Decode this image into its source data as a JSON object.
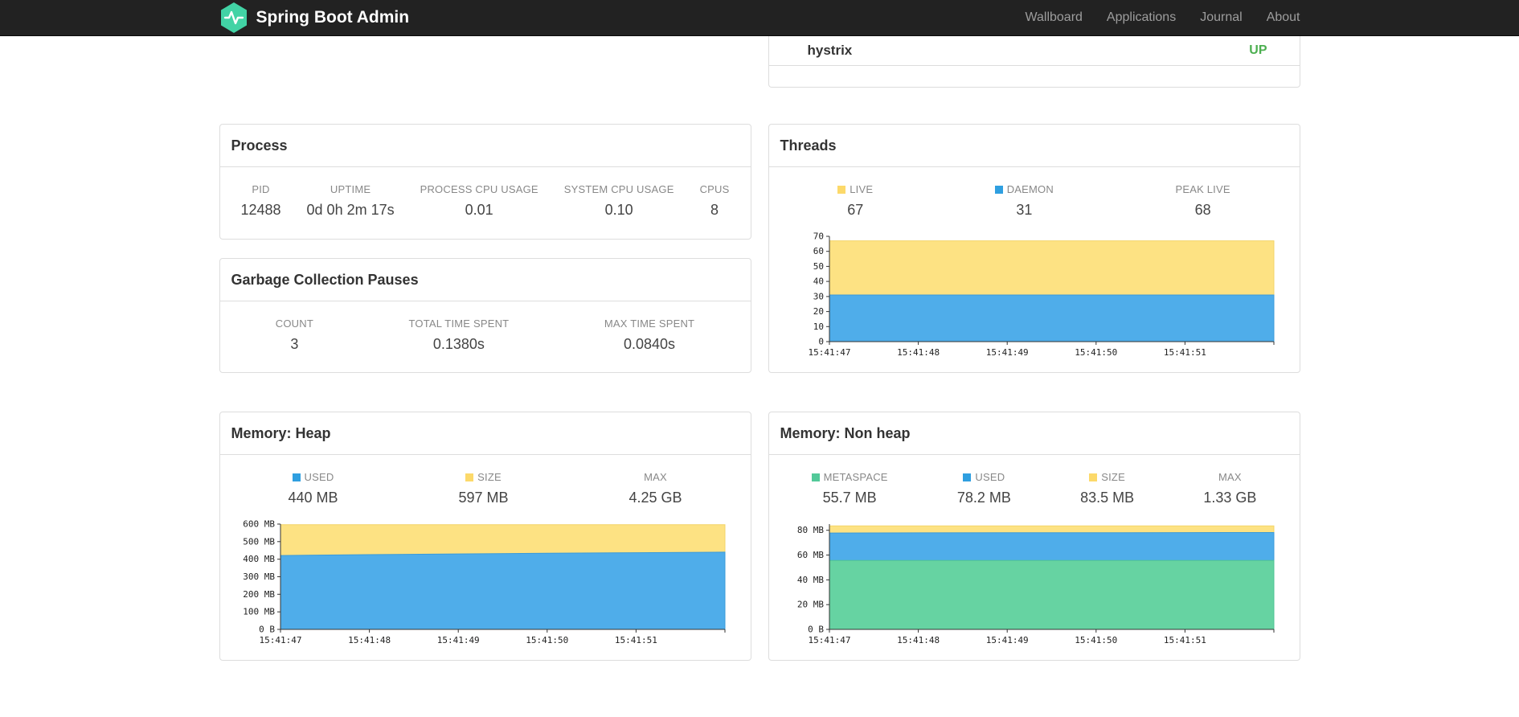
{
  "navbar": {
    "brand": "Spring Boot Admin",
    "logo_color": "#42d3a5",
    "links": [
      {
        "label": "Wallboard"
      },
      {
        "label": "Applications"
      },
      {
        "label": "Journal"
      },
      {
        "label": "About"
      }
    ]
  },
  "colors": {
    "status_up": "#4caf50",
    "chart_yellow": "#fde283",
    "chart_blue": "#4fadea",
    "chart_green": "#66d3a2"
  },
  "health": {
    "item_label": "hystrix",
    "item_status": "UP"
  },
  "process": {
    "title": "Process",
    "stats": [
      {
        "label": "PID",
        "value": "12488"
      },
      {
        "label": "UPTIME",
        "value": "0d 0h 2m 17s"
      },
      {
        "label": "PROCESS CPU USAGE",
        "value": "0.01"
      },
      {
        "label": "SYSTEM CPU USAGE",
        "value": "0.10"
      },
      {
        "label": "CPUS",
        "value": "8"
      }
    ]
  },
  "gc": {
    "title": "Garbage Collection Pauses",
    "stats": [
      {
        "label": "COUNT",
        "value": "3"
      },
      {
        "label": "TOTAL TIME SPENT",
        "value": "0.1380s"
      },
      {
        "label": "MAX TIME SPENT",
        "value": "0.0840s"
      }
    ]
  },
  "threads": {
    "title": "Threads",
    "stats": [
      {
        "label": "LIVE",
        "value": "67",
        "swatch": "#fcd96a"
      },
      {
        "label": "DAEMON",
        "value": "31",
        "swatch": "#2f9fe0"
      },
      {
        "label": "PEAK LIVE",
        "value": "68"
      }
    ]
  },
  "heap": {
    "title": "Memory: Heap",
    "stats": [
      {
        "label": "USED",
        "value": "440 MB",
        "swatch": "#2f9fe0"
      },
      {
        "label": "SIZE",
        "value": "597 MB",
        "swatch": "#fcd96a"
      },
      {
        "label": "MAX",
        "value": "4.25 GB"
      }
    ]
  },
  "nonheap": {
    "title": "Memory: Non heap",
    "stats": [
      {
        "label": "METASPACE",
        "value": "55.7 MB",
        "swatch": "#52c999"
      },
      {
        "label": "USED",
        "value": "78.2 MB",
        "swatch": "#2f9fe0"
      },
      {
        "label": "SIZE",
        "value": "83.5 MB",
        "swatch": "#fcd96a"
      },
      {
        "label": "MAX",
        "value": "1.33 GB"
      }
    ]
  },
  "chart_data": [
    {
      "type": "area",
      "title": "Threads",
      "x": [
        "15:41:47",
        "15:41:48",
        "15:41:49",
        "15:41:50",
        "15:41:51"
      ],
      "y_max": 70,
      "y_ticks": [
        0,
        10,
        20,
        30,
        40,
        50,
        60,
        70
      ],
      "y_tick_labels": [
        "0",
        "10",
        "20",
        "30",
        "40",
        "50",
        "60",
        "70"
      ],
      "legend_position": "top",
      "grid": false,
      "series": [
        {
          "name": "LIVE",
          "color": "#fde283",
          "stroke": "#f3d468",
          "values": [
            67,
            67,
            67,
            67,
            67,
            67
          ]
        },
        {
          "name": "DAEMON",
          "color": "#4fadea",
          "stroke": "#3b9bd9",
          "values": [
            31,
            31,
            31,
            31,
            31,
            31
          ]
        }
      ]
    },
    {
      "type": "area",
      "title": "Memory: Heap",
      "x": [
        "15:41:47",
        "15:41:48",
        "15:41:49",
        "15:41:50",
        "15:41:51"
      ],
      "y_max": 600,
      "y_ticks": [
        0,
        100,
        200,
        300,
        400,
        500,
        600
      ],
      "y_tick_labels": [
        "0 B",
        "100 MB",
        "200 MB",
        "300 MB",
        "400 MB",
        "500 MB",
        "600 MB"
      ],
      "legend_position": "top",
      "grid": false,
      "series": [
        {
          "name": "SIZE",
          "color": "#fde283",
          "stroke": "#f3d468",
          "values": [
            597,
            597,
            597,
            597,
            597,
            597
          ]
        },
        {
          "name": "USED",
          "color": "#4fadea",
          "stroke": "#3b9bd9",
          "values": [
            421,
            426,
            430,
            434,
            437,
            440
          ]
        }
      ]
    },
    {
      "type": "area",
      "title": "Memory: Non heap",
      "x": [
        "15:41:47",
        "15:41:48",
        "15:41:49",
        "15:41:50",
        "15:41:51"
      ],
      "y_max": 85,
      "y_ticks": [
        0,
        20,
        40,
        60,
        80
      ],
      "y_tick_labels": [
        "0 B",
        "20 MB",
        "40 MB",
        "60 MB",
        "80 MB"
      ],
      "legend_position": "top",
      "grid": false,
      "series": [
        {
          "name": "SIZE",
          "color": "#fde283",
          "stroke": "#f3d468",
          "values": [
            83.5,
            83.5,
            83.5,
            83.5,
            83.5,
            83.5
          ]
        },
        {
          "name": "USED",
          "color": "#4fadea",
          "stroke": "#3b9bd9",
          "values": [
            77.8,
            77.9,
            78,
            78,
            78.1,
            78.2
          ]
        },
        {
          "name": "METASPACE",
          "color": "#66d3a2",
          "stroke": "#4fc394",
          "values": [
            55.7,
            55.7,
            55.7,
            55.7,
            55.7,
            55.7
          ]
        }
      ]
    }
  ]
}
